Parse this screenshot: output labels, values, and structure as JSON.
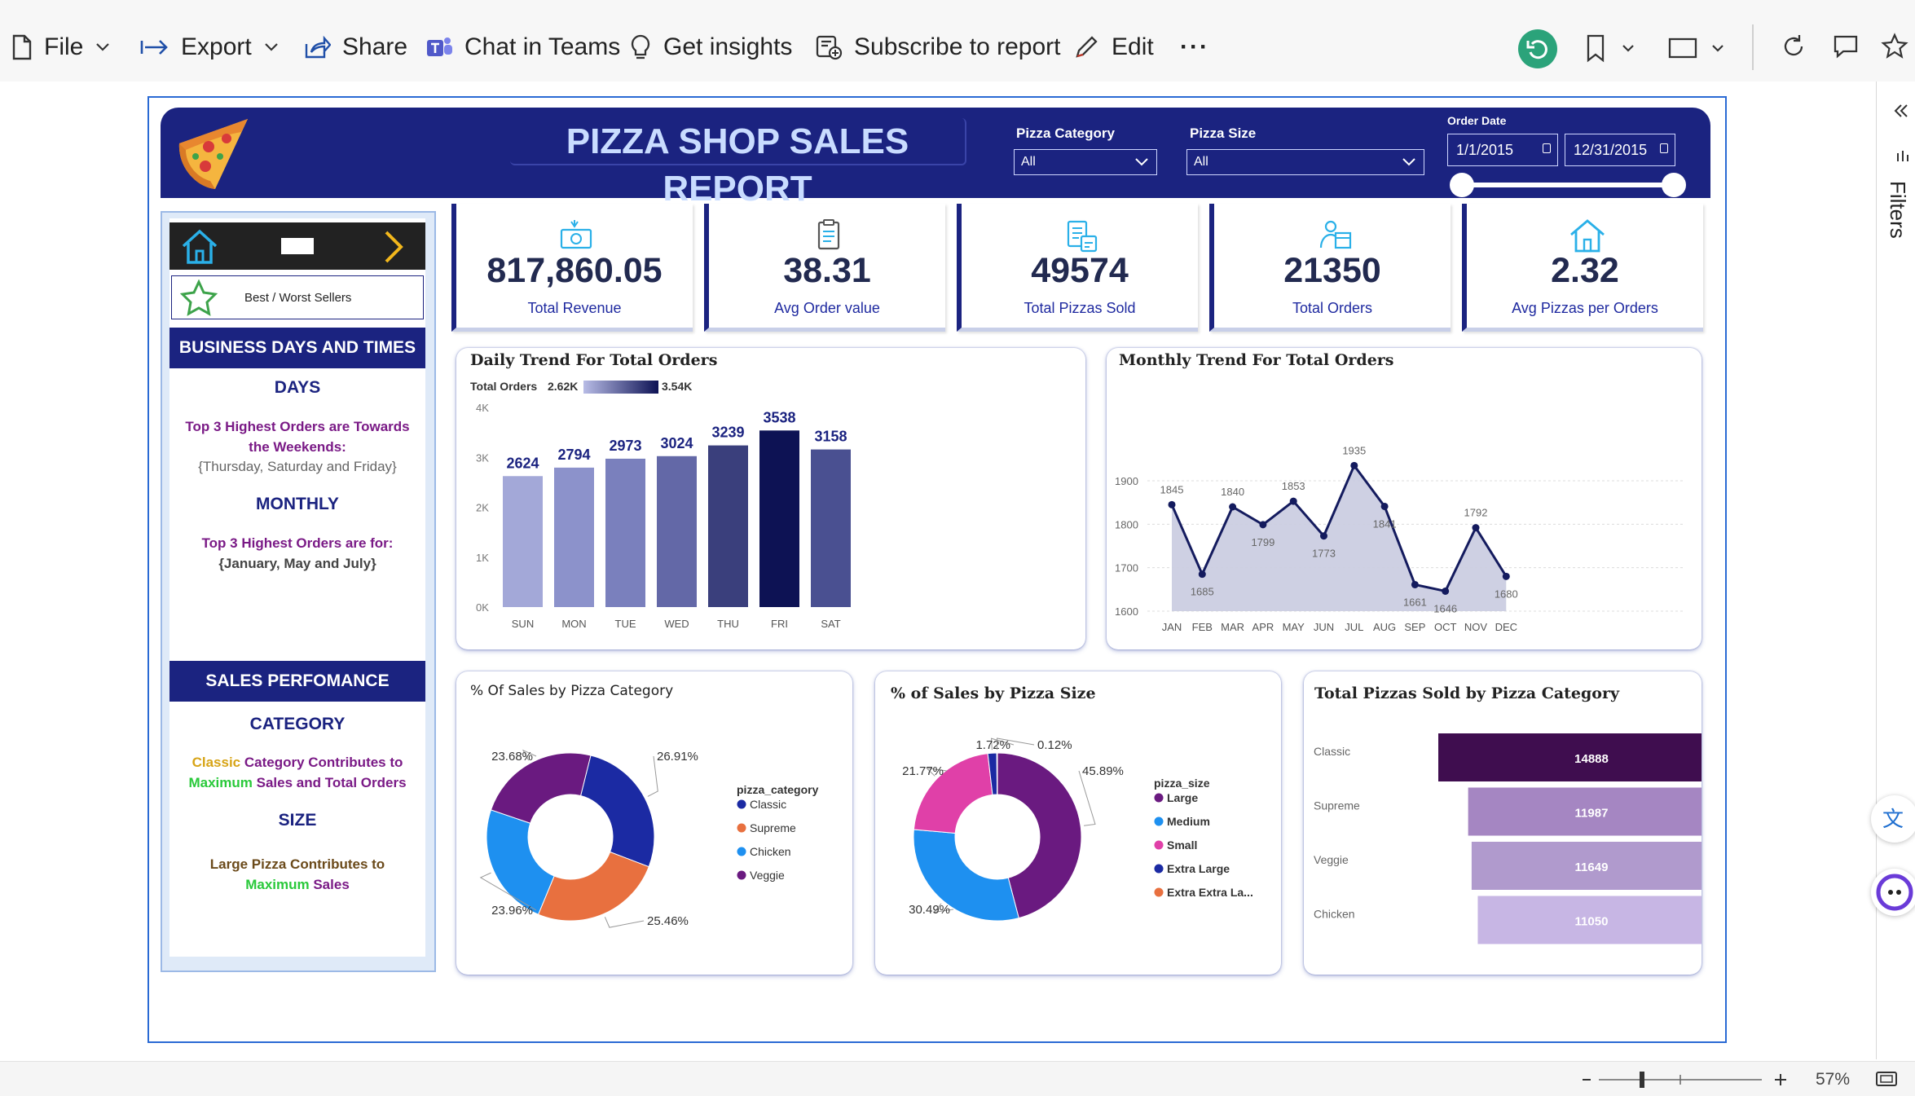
{
  "toolbar": {
    "file": "File",
    "export": "Export",
    "share": "Share",
    "chat_in_teams": "Chat in Teams",
    "get_insights": "Get insights",
    "subscribe": "Subscribe to report",
    "edit": "Edit",
    "more": "···"
  },
  "header": {
    "title": "PIZZA SHOP SALES REPORT",
    "pizza_category_label": "Pizza Category",
    "pizza_category_value": "All",
    "pizza_size_label": "Pizza Size",
    "pizza_size_value": "All",
    "order_date_label": "Order Date",
    "date_start": "1/1/2015",
    "date_end": "12/31/2015"
  },
  "left_panel": {
    "best_worst_label": "Best / Worst Sellers",
    "business_heading": "BUSINESS DAYS AND TIMES",
    "days_heading": "DAYS",
    "days_line1": "Top 3 Highest Orders are Towards",
    "days_line2": "the Weekends:",
    "days_line3": "{Thursday, Saturday and Friday}",
    "monthly_heading": "MONTHLY",
    "monthly_line1": "Top 3 Highest Orders are for:",
    "monthly_line2": "{January, May and July}",
    "sales_heading": "SALES PERFOMANCE",
    "category_heading": "CATEGORY",
    "category_word1": "Classic",
    "category_text1": " Category Contributes to",
    "category_word2": "Maximum",
    "category_text2": " Sales and Total Orders",
    "size_heading": "SIZE",
    "size_text1": "Large Pizza Contributes to",
    "size_word": "Maximum",
    "size_text2": " Sales"
  },
  "kpis": [
    {
      "value": "817,860.05",
      "label": "Total Revenue",
      "icon": "money-icon"
    },
    {
      "value": "38.31",
      "label": "Avg Order value",
      "icon": "clipboard-icon"
    },
    {
      "value": "49574",
      "label": "Total Pizzas Sold",
      "icon": "receipt-icon"
    },
    {
      "value": "21350",
      "label": "Total Orders",
      "icon": "delivery-icon"
    },
    {
      "value": "2.32",
      "label": "Avg Pizzas per Orders",
      "icon": "home-icon"
    }
  ],
  "chart_data": [
    {
      "type": "bar",
      "title": "Daily Trend For Total Orders",
      "legend_title": "Total Orders",
      "legend_min": "2.62K",
      "legend_max": "3.54K",
      "categories": [
        "SUN",
        "MON",
        "TUE",
        "WED",
        "THU",
        "FRI",
        "SAT"
      ],
      "values": [
        2624,
        2794,
        2973,
        3024,
        3239,
        3538,
        3158
      ],
      "y_ticks": [
        "0K",
        "1K",
        "2K",
        "3K",
        "4K"
      ],
      "ylim": [
        0,
        4000
      ],
      "colors": [
        "#a3a8d8",
        "#8c92cb",
        "#7a80bd",
        "#6368a7",
        "#3a3f7c",
        "#0d1254",
        "#4a5091"
      ]
    },
    {
      "type": "area",
      "title": "Monthly Trend For Total Orders",
      "categories": [
        "JAN",
        "FEB",
        "MAR",
        "APR",
        "MAY",
        "JUN",
        "JUL",
        "AUG",
        "SEP",
        "OCT",
        "NOV",
        "DEC"
      ],
      "values": [
        1845,
        1685,
        1840,
        1799,
        1853,
        1773,
        1935,
        1841,
        1661,
        1646,
        1792,
        1680
      ],
      "y_ticks": [
        "1600",
        "1700",
        "1800",
        "1900"
      ],
      "ylim": [
        1600,
        1960
      ]
    },
    {
      "type": "pie",
      "title": "% Of Sales by Pizza Category",
      "legend_title": "pizza_category",
      "labels": [
        "Classic",
        "Supreme",
        "Chicken",
        "Veggie"
      ],
      "values": [
        26.91,
        25.46,
        23.96,
        23.68
      ],
      "value_labels": [
        "26.91%",
        "25.46%",
        "23.96%",
        "23.68%"
      ],
      "colors": [
        "#1b2aa3",
        "#e8703f",
        "#1e90f0",
        "#6a1a80"
      ]
    },
    {
      "type": "pie",
      "title": "% of Sales by Pizza Size",
      "legend_title": "pizza_size",
      "labels": [
        "Large",
        "Medium",
        "Small",
        "Extra Large",
        "Extra Extra La..."
      ],
      "values": [
        45.89,
        30.49,
        21.77,
        1.72,
        0.12
      ],
      "value_labels": [
        "45.89%",
        "30.49%",
        "21.77%",
        "1.72%",
        "0.12%"
      ],
      "colors": [
        "#6a1a80",
        "#1e90f0",
        "#e040a8",
        "#1b2aa3",
        "#e8703f"
      ]
    },
    {
      "type": "bar",
      "title": "Total Pizzas Sold by Pizza Category",
      "orientation": "funnel",
      "categories": [
        "Classic",
        "Supreme",
        "Veggie",
        "Chicken"
      ],
      "values": [
        14888,
        11987,
        11649,
        11050
      ],
      "colors": [
        "#3f0d4f",
        "#a586c2",
        "#b09acd",
        "#c7b6e4"
      ]
    }
  ],
  "status": {
    "zoom": "57%"
  },
  "right_rail": {
    "filters_label": "Filters"
  }
}
